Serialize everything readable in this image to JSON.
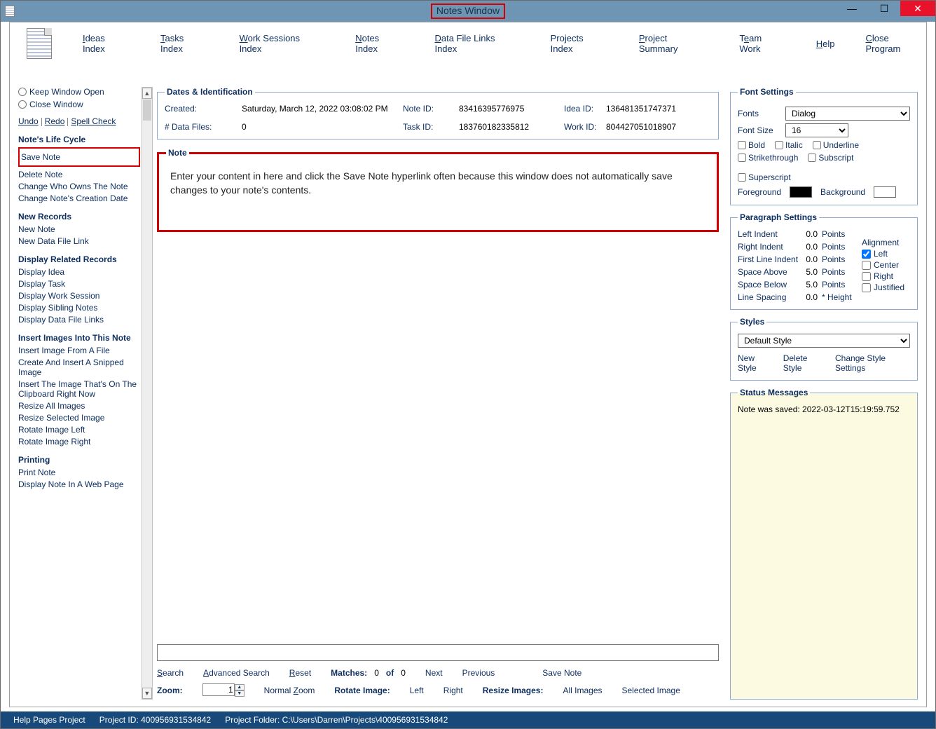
{
  "title": "Notes Window",
  "menubar": [
    "Ideas Index",
    "Tasks Index",
    "Work Sessions Index",
    "Notes Index",
    "Data File Links Index",
    "Projects Index",
    "Project Summary",
    "Team Work",
    "Help",
    "Close Program"
  ],
  "sidebar": {
    "keep_open": "Keep Window Open",
    "close_win": "Close Window",
    "undo": "Undo",
    "redo": "Redo",
    "spell": "Spell Check",
    "sec_life": "Note's Life Cycle",
    "save_note": "Save Note",
    "delete_note": "Delete Note",
    "change_owner": "Change Who Owns The Note",
    "change_date": "Change Note's Creation Date",
    "sec_new": "New Records",
    "new_note": "New Note",
    "new_link": "New Data File Link",
    "sec_related": "Display Related Records",
    "disp_idea": "Display Idea",
    "disp_task": "Display Task",
    "disp_ws": "Display Work Session",
    "disp_sib": "Display Sibling Notes",
    "disp_links": "Display Data File Links",
    "sec_images": "Insert Images Into This Note",
    "ins_file": "Insert Image From A File",
    "ins_snip": "Create And Insert A Snipped Image",
    "ins_clip": "Insert The Image That's On The Clipboard Right Now",
    "resize_all": "Resize All Images",
    "resize_sel": "Resize Selected Image",
    "rot_left": "Rotate Image Left",
    "rot_right": "Rotate Image Right",
    "sec_print": "Printing",
    "print_note": "Print Note",
    "display_web": "Display Note In A Web Page"
  },
  "dates": {
    "legend": "Dates & Identification",
    "created_lbl": "Created:",
    "created_val": "Saturday, March 12, 2022   03:08:02 PM",
    "files_lbl": "# Data Files:",
    "files_val": "0",
    "noteid_lbl": "Note ID:",
    "noteid_val": "83416395776975",
    "taskid_lbl": "Task ID:",
    "taskid_val": "183760182335812",
    "ideaid_lbl": "Idea ID:",
    "ideaid_val": "136481351747371",
    "workid_lbl": "Work ID:",
    "workid_val": "804427051018907"
  },
  "note": {
    "legend": "Note",
    "text": "Enter your content in here and click the Save Note hyperlink often because this window does not automatically save changes to your note's contents."
  },
  "searchbar": {
    "search": "Search",
    "adv": "Advanced Search",
    "reset": "Reset",
    "matches_lbl": "Matches:",
    "matches_val": "0",
    "of": "of",
    "of_val": "0",
    "next": "Next",
    "prev": "Previous",
    "save": "Save Note"
  },
  "zoombar": {
    "zoom_lbl": "Zoom:",
    "zoom_val": "1",
    "normal": "Normal Zoom",
    "rotate_lbl": "Rotate Image:",
    "left": "Left",
    "right": "Right",
    "resize_lbl": "Resize Images:",
    "all": "All Images",
    "sel": "Selected Image"
  },
  "font": {
    "legend": "Font Settings",
    "fonts_lbl": "Fonts",
    "fonts_val": "Dialog",
    "size_lbl": "Font Size",
    "size_val": "16",
    "bold": "Bold",
    "italic": "Italic",
    "underline": "Underline",
    "strike": "Strikethrough",
    "sub": "Subscript",
    "sup": "Superscript",
    "fg": "Foreground",
    "fg_hex": "#000000",
    "bg": "Background",
    "bg_hex": "#ffffff"
  },
  "para": {
    "legend": "Paragraph Settings",
    "left": "Left Indent",
    "left_v": "0.0",
    "right": "Right Indent",
    "right_v": "0.0",
    "first": "First Line Indent",
    "first_v": "0.0",
    "above": "Space Above",
    "above_v": "5.0",
    "below": "Space Below",
    "below_v": "5.0",
    "spacing": "Line Spacing",
    "spacing_v": "0.0",
    "points": "Points",
    "height": "* Height",
    "align_hdr": "Alignment",
    "a_left": "Left",
    "a_center": "Center",
    "a_right": "Right",
    "a_just": "Justified"
  },
  "styles": {
    "legend": "Styles",
    "sel": "Default Style",
    "new": "New Style",
    "del": "Delete Style",
    "chg": "Change Style Settings"
  },
  "msg": {
    "legend": "Status Messages",
    "text": "Note was saved:  2022-03-12T15:19:59.752"
  },
  "status": {
    "proj": "Help Pages Project",
    "id_lbl": "Project ID:",
    "id_val": "400956931534842",
    "folder_lbl": "Project Folder:",
    "folder_val": "C:\\Users\\Darren\\Projects\\400956931534842"
  }
}
